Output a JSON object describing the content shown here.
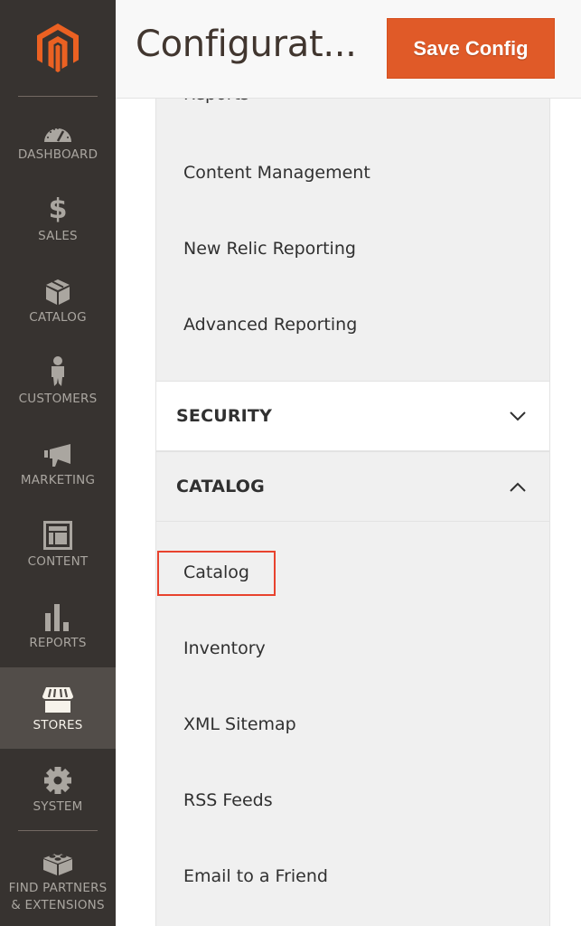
{
  "sidebar": {
    "logo": "magento-logo",
    "items": [
      {
        "label": "DASHBOARD",
        "icon": "dashboard-gauge-icon",
        "active": false
      },
      {
        "label": "SALES",
        "icon": "dollar-icon",
        "active": false
      },
      {
        "label": "CATALOG",
        "icon": "box-icon",
        "active": false
      },
      {
        "label": "CUSTOMERS",
        "icon": "person-icon",
        "active": false
      },
      {
        "label": "MARKETING",
        "icon": "megaphone-icon",
        "active": false
      },
      {
        "label": "CONTENT",
        "icon": "layout-icon",
        "active": false
      },
      {
        "label": "REPORTS",
        "icon": "bar-chart-icon",
        "active": false
      },
      {
        "label": "STORES",
        "icon": "storefront-icon",
        "active": true
      },
      {
        "label": "SYSTEM",
        "icon": "gear-icon",
        "active": false
      },
      {
        "label": "FIND PARTNERS & EXTENSIONS",
        "icon": "lego-brick-icon",
        "active": false
      }
    ]
  },
  "header": {
    "title": "Configurat...",
    "save_label": "Save Config"
  },
  "colors": {
    "accent": "#e05a28",
    "sidebar_bg": "#373330",
    "sidebar_active": "#524d49",
    "highlight": "#e8432e"
  },
  "panel": {
    "reports_links": [
      "Reports",
      "Content Management",
      "New Relic Reporting",
      "Advanced Reporting"
    ],
    "sections": [
      {
        "title": "SECURITY",
        "expanded": false
      },
      {
        "title": "CATALOG",
        "expanded": true
      }
    ],
    "catalog_links": [
      "Catalog",
      "Inventory",
      "XML Sitemap",
      "RSS Feeds",
      "Email to a Friend"
    ],
    "highlighted_link": "Catalog"
  }
}
